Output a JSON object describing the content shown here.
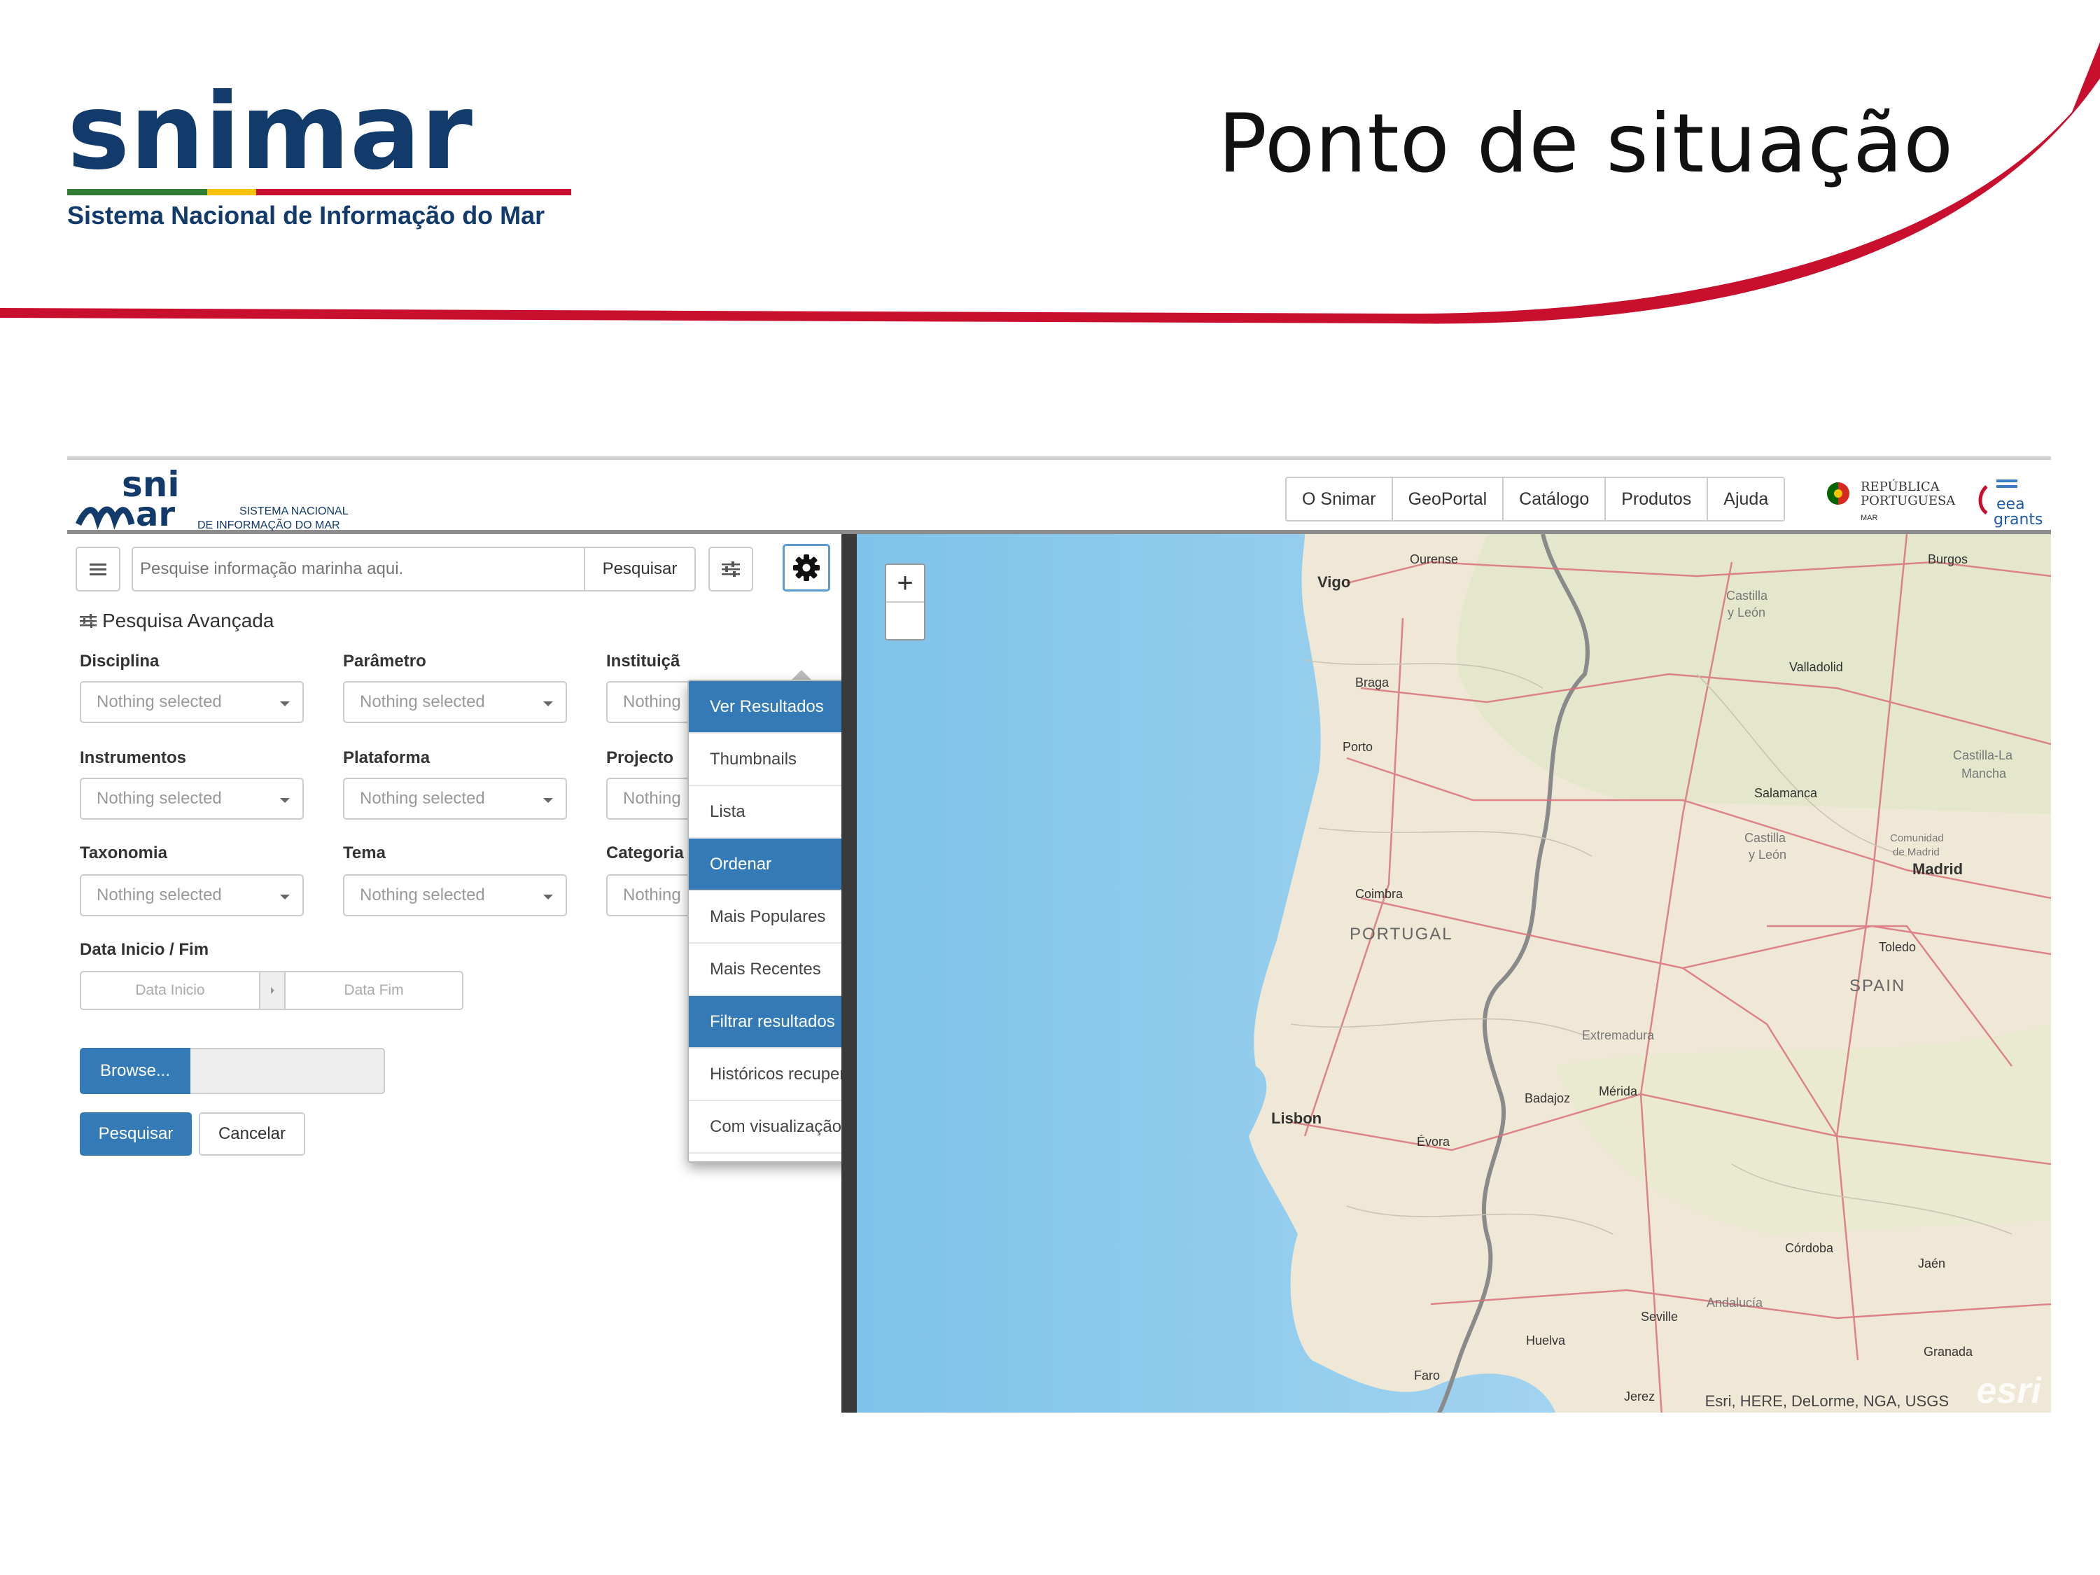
{
  "slide": {
    "title": "Ponto de situação",
    "logo_text": "snimar",
    "logo_subtitle": "Sistema Nacional de Informação do Mar",
    "accent_color": "#c8102e"
  },
  "app": {
    "logo_text": "snimar",
    "logo_line1": "SISTEMA NACIONAL",
    "logo_line2": "DE INFORMAÇÃO DO MAR",
    "nav": [
      "O Snimar",
      "GeoPortal",
      "Catálogo",
      "Produtos",
      "Ajuda"
    ],
    "republica_line1": "REPÚBLICA",
    "republica_line2": "PORTUGUESA",
    "republica_line3": "MAR",
    "eea_line1": "eea",
    "eea_line2": "grants"
  },
  "search": {
    "placeholder": "Pesquise informação marinha aqui.",
    "button": "Pesquisar"
  },
  "advanced": {
    "title": "Pesquisa Avançada",
    "fields": [
      {
        "label": "Disciplina",
        "value": "Nothing selected"
      },
      {
        "label": "Parâmetro",
        "value": "Nothing selected"
      },
      {
        "label": "Instituiçã",
        "value": "Nothing"
      },
      {
        "label": "Instrumentos",
        "value": "Nothing selected"
      },
      {
        "label": "Plataforma",
        "value": "Nothing selected"
      },
      {
        "label": "Projecto",
        "value": "Nothing"
      },
      {
        "label": "Taxonomia",
        "value": "Nothing selected"
      },
      {
        "label": "Tema",
        "value": "Nothing selected"
      },
      {
        "label": "Categoria",
        "value": "Nothing"
      }
    ],
    "date_label": "Data Inicio / Fim",
    "date_start_placeholder": "Data Inicio",
    "date_end_placeholder": "Data Fim",
    "browse_label": "Browse...",
    "submit_label": "Pesquisar",
    "cancel_label": "Cancelar"
  },
  "dropdown": {
    "items": [
      {
        "label": "Ver Resultados",
        "header": true
      },
      {
        "label": "Thumbnails",
        "header": false
      },
      {
        "label": "Lista",
        "header": false
      },
      {
        "label": "Ordenar",
        "header": true
      },
      {
        "label": "Mais Populares",
        "header": false
      },
      {
        "label": "Mais Recentes",
        "header": false
      },
      {
        "label": "Filtrar resultados",
        "header": true
      },
      {
        "label": "Históricos recuperados",
        "header": false
      },
      {
        "label": "Com visualização",
        "header": false
      }
    ],
    "header_color": "#337ab7"
  },
  "map": {
    "zoom_in": "+",
    "attribution": "Esri, HERE, DeLorme, NGA, USGS",
    "esri_logo": "esri",
    "labels": {
      "ourense": "Ourense",
      "vigo": "Vigo",
      "burgos": "Burgos",
      "castilla": "Castilla",
      "yleon": "y León",
      "braga": "Braga",
      "valladolid": "Valladolid",
      "porto": "Porto",
      "salamanca": "Salamanca",
      "castilla_la": "Castilla-La",
      "mancha": "Mancha",
      "castilla2": "Castilla",
      "yleon2": "y León",
      "comunidad": "Comunidad",
      "de_madrid": "de Madrid",
      "madrid": "Madrid",
      "coimbra": "Coimbra",
      "portugal": "PORTUGAL",
      "toledo": "Toledo",
      "spain": "SPAIN",
      "extremadura": "Extremadura",
      "badajoz": "Badajoz",
      "merida": "Mérida",
      "lisbon": "Lisbon",
      "evora": "Évora",
      "cordoba": "Córdoba",
      "jaen": "Jaén",
      "andalucia": "Andalucía",
      "seville": "Seville",
      "huelva": "Huelva",
      "granada": "Granada",
      "faro": "Faro",
      "jerez": "Jerez"
    }
  }
}
